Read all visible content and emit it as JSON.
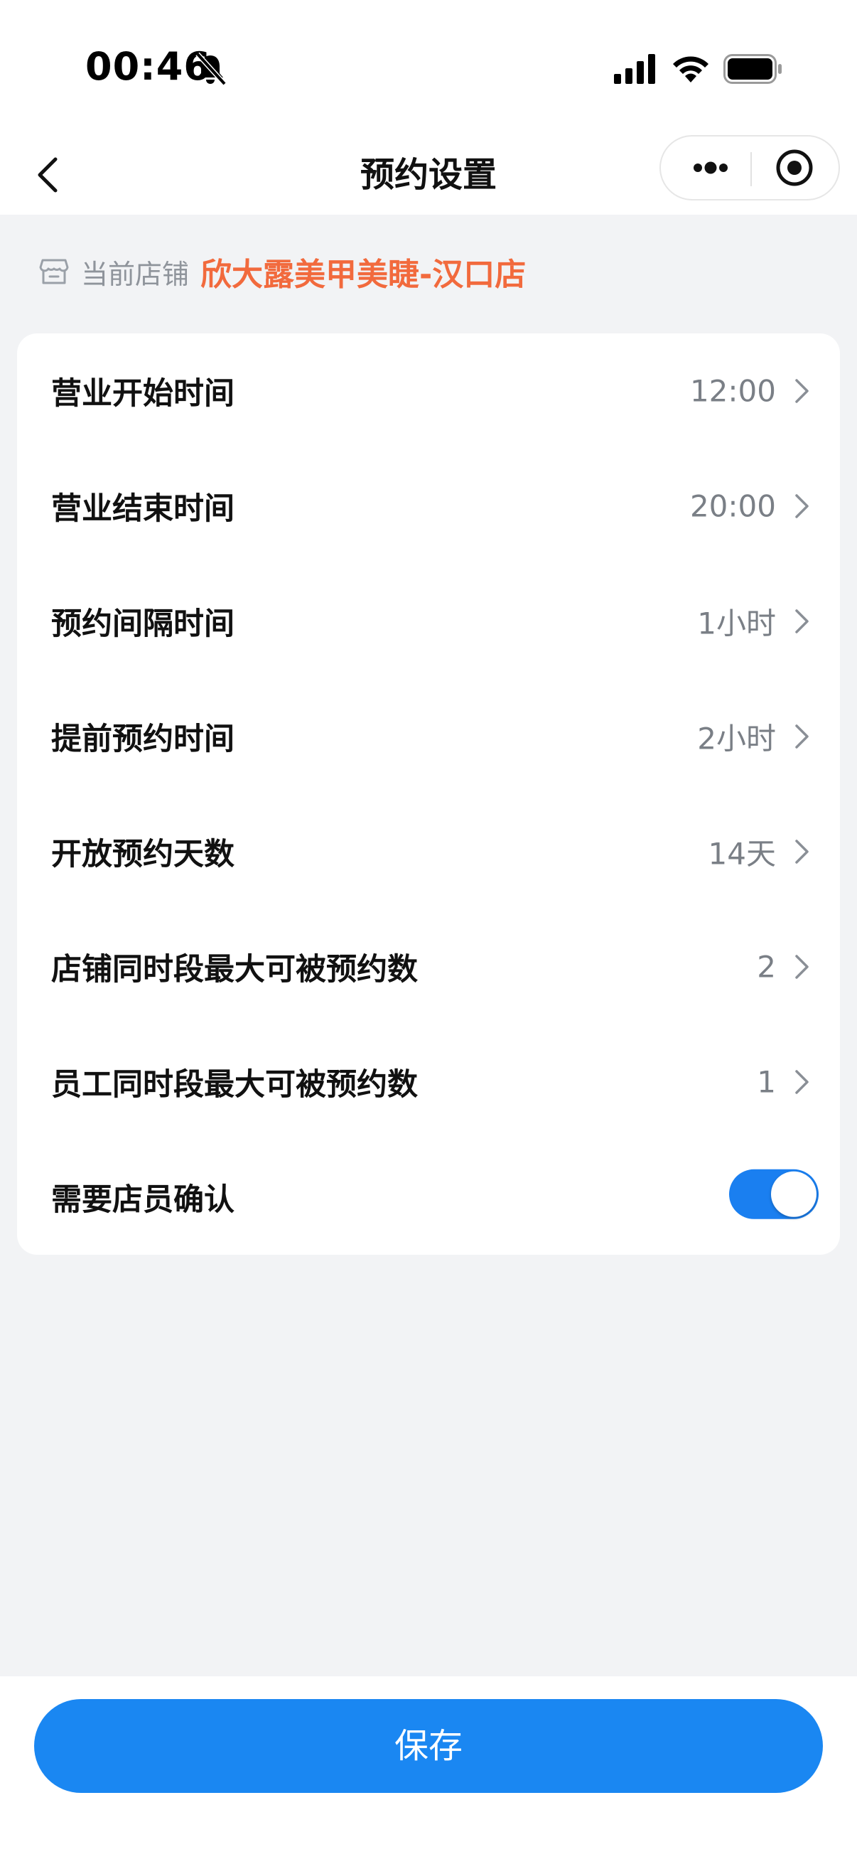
{
  "status_bar": {
    "time": "00:46",
    "icons": [
      "bell-slash-icon",
      "signal-icon",
      "wifi-icon",
      "battery-icon"
    ]
  },
  "nav": {
    "title": "预约设置",
    "back_icon": "chevron-left-icon",
    "more_icon": "ellipsis-icon",
    "close_icon": "target-circle-icon"
  },
  "store": {
    "label": "当前店铺",
    "name": "欣大露美甲美睫-汉口店",
    "icon": "store-icon"
  },
  "settings": [
    {
      "label": "营业开始时间",
      "value": "12:00"
    },
    {
      "label": "营业结束时间",
      "value": "20:00"
    },
    {
      "label": "预约间隔时间",
      "value": "1小时"
    },
    {
      "label": "提前预约时间",
      "value": "2小时"
    },
    {
      "label": "开放预约天数",
      "value": "14天"
    },
    {
      "label": "店铺同时段最大可被预约数",
      "value": "2"
    },
    {
      "label": "员工同时段最大可被预约数",
      "value": "1"
    }
  ],
  "confirm_toggle": {
    "label": "需要店员确认",
    "on": true
  },
  "save_label": "保存",
  "colors": {
    "accent_blue": "#1a87f2",
    "store_orange": "#f26a3d",
    "background": "#f2f3f5"
  }
}
